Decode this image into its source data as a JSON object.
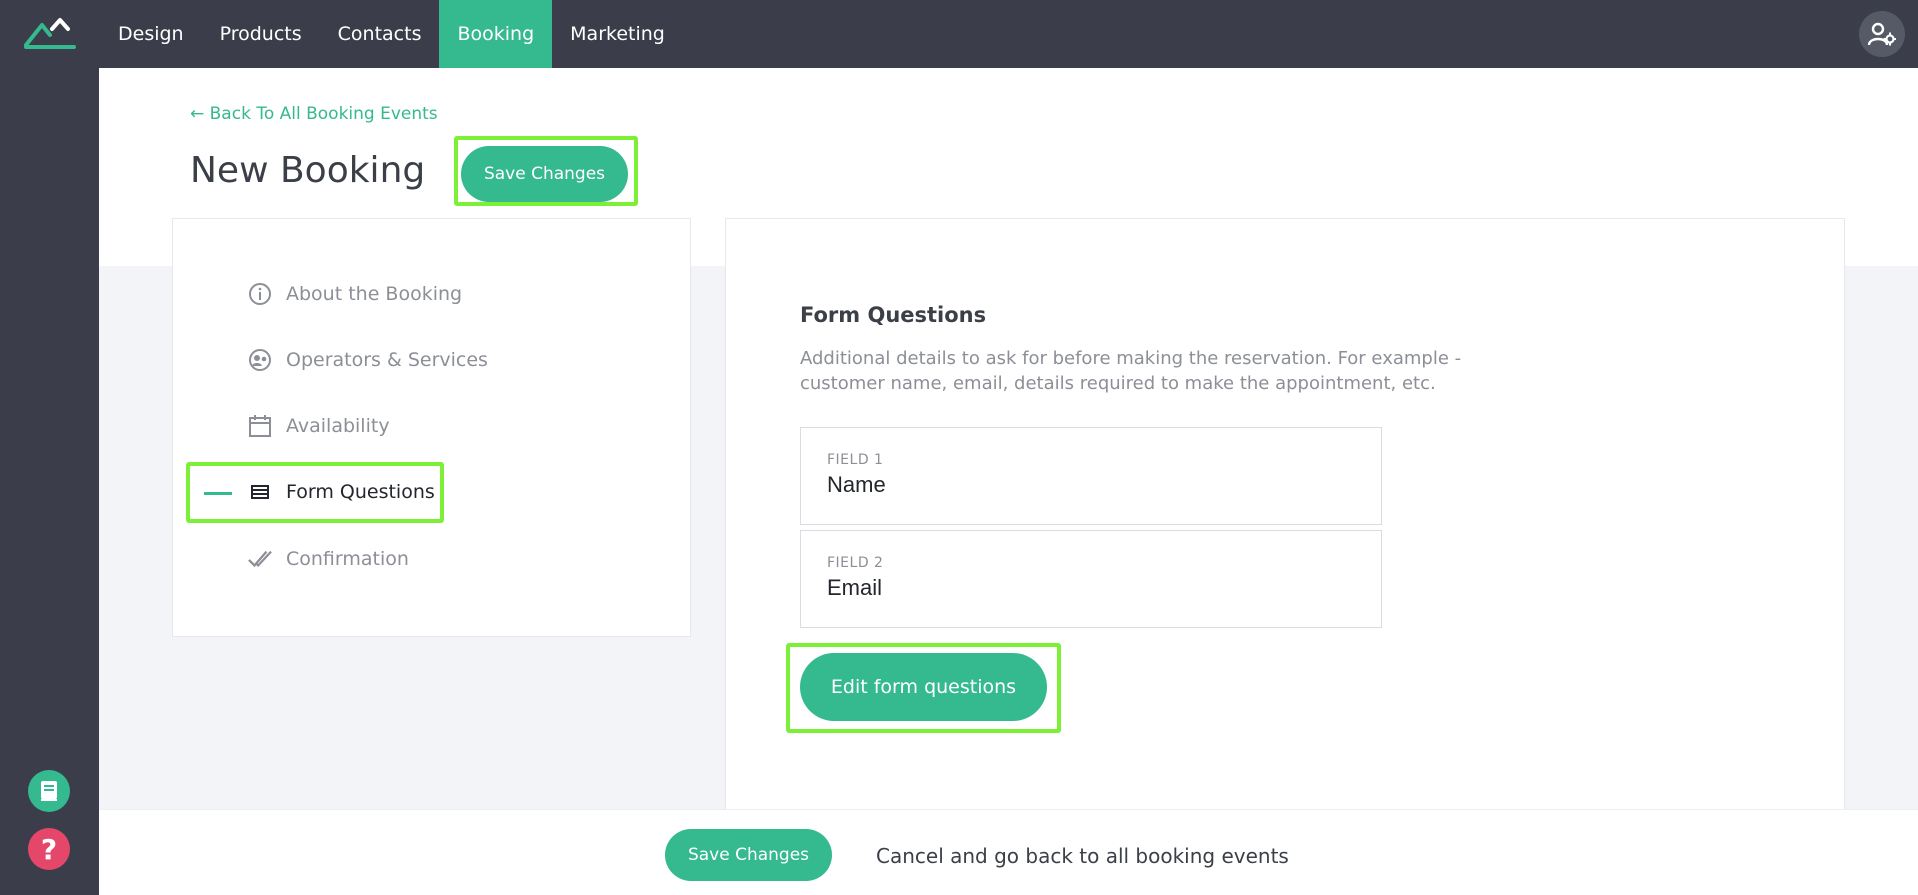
{
  "nav": {
    "items": [
      {
        "label": "Design"
      },
      {
        "label": "Products"
      },
      {
        "label": "Contacts"
      },
      {
        "label": "Booking"
      },
      {
        "label": "Marketing"
      }
    ],
    "active": "Booking"
  },
  "header": {
    "back_link": "← Back To All Booking Events",
    "title": "New Booking",
    "save_label": "Save Changes"
  },
  "steps": {
    "items": [
      {
        "label": "About the Booking",
        "icon": "info-icon"
      },
      {
        "label": "Operators & Services",
        "icon": "operators-icon"
      },
      {
        "label": "Availability",
        "icon": "calendar-icon"
      },
      {
        "label": "Form Questions",
        "icon": "list-icon"
      },
      {
        "label": "Confirmation",
        "icon": "double-check-icon"
      }
    ],
    "active": "Form Questions"
  },
  "form_questions": {
    "title": "Form Questions",
    "description": "Additional details to ask for before making the reservation. For example - customer name, email, details required to make the appointment, etc.",
    "fields": [
      {
        "label": "FIELD 1",
        "value": "Name"
      },
      {
        "label": "FIELD 2",
        "value": "Email"
      }
    ],
    "edit_label": "Edit form questions"
  },
  "footer": {
    "save_label": "Save Changes",
    "cancel_label": "Cancel and go back to all booking events"
  },
  "colors": {
    "accent": "#35b98f",
    "topbar": "#3b3e4a",
    "highlight": "#7cf037",
    "help": "#e5476b"
  }
}
